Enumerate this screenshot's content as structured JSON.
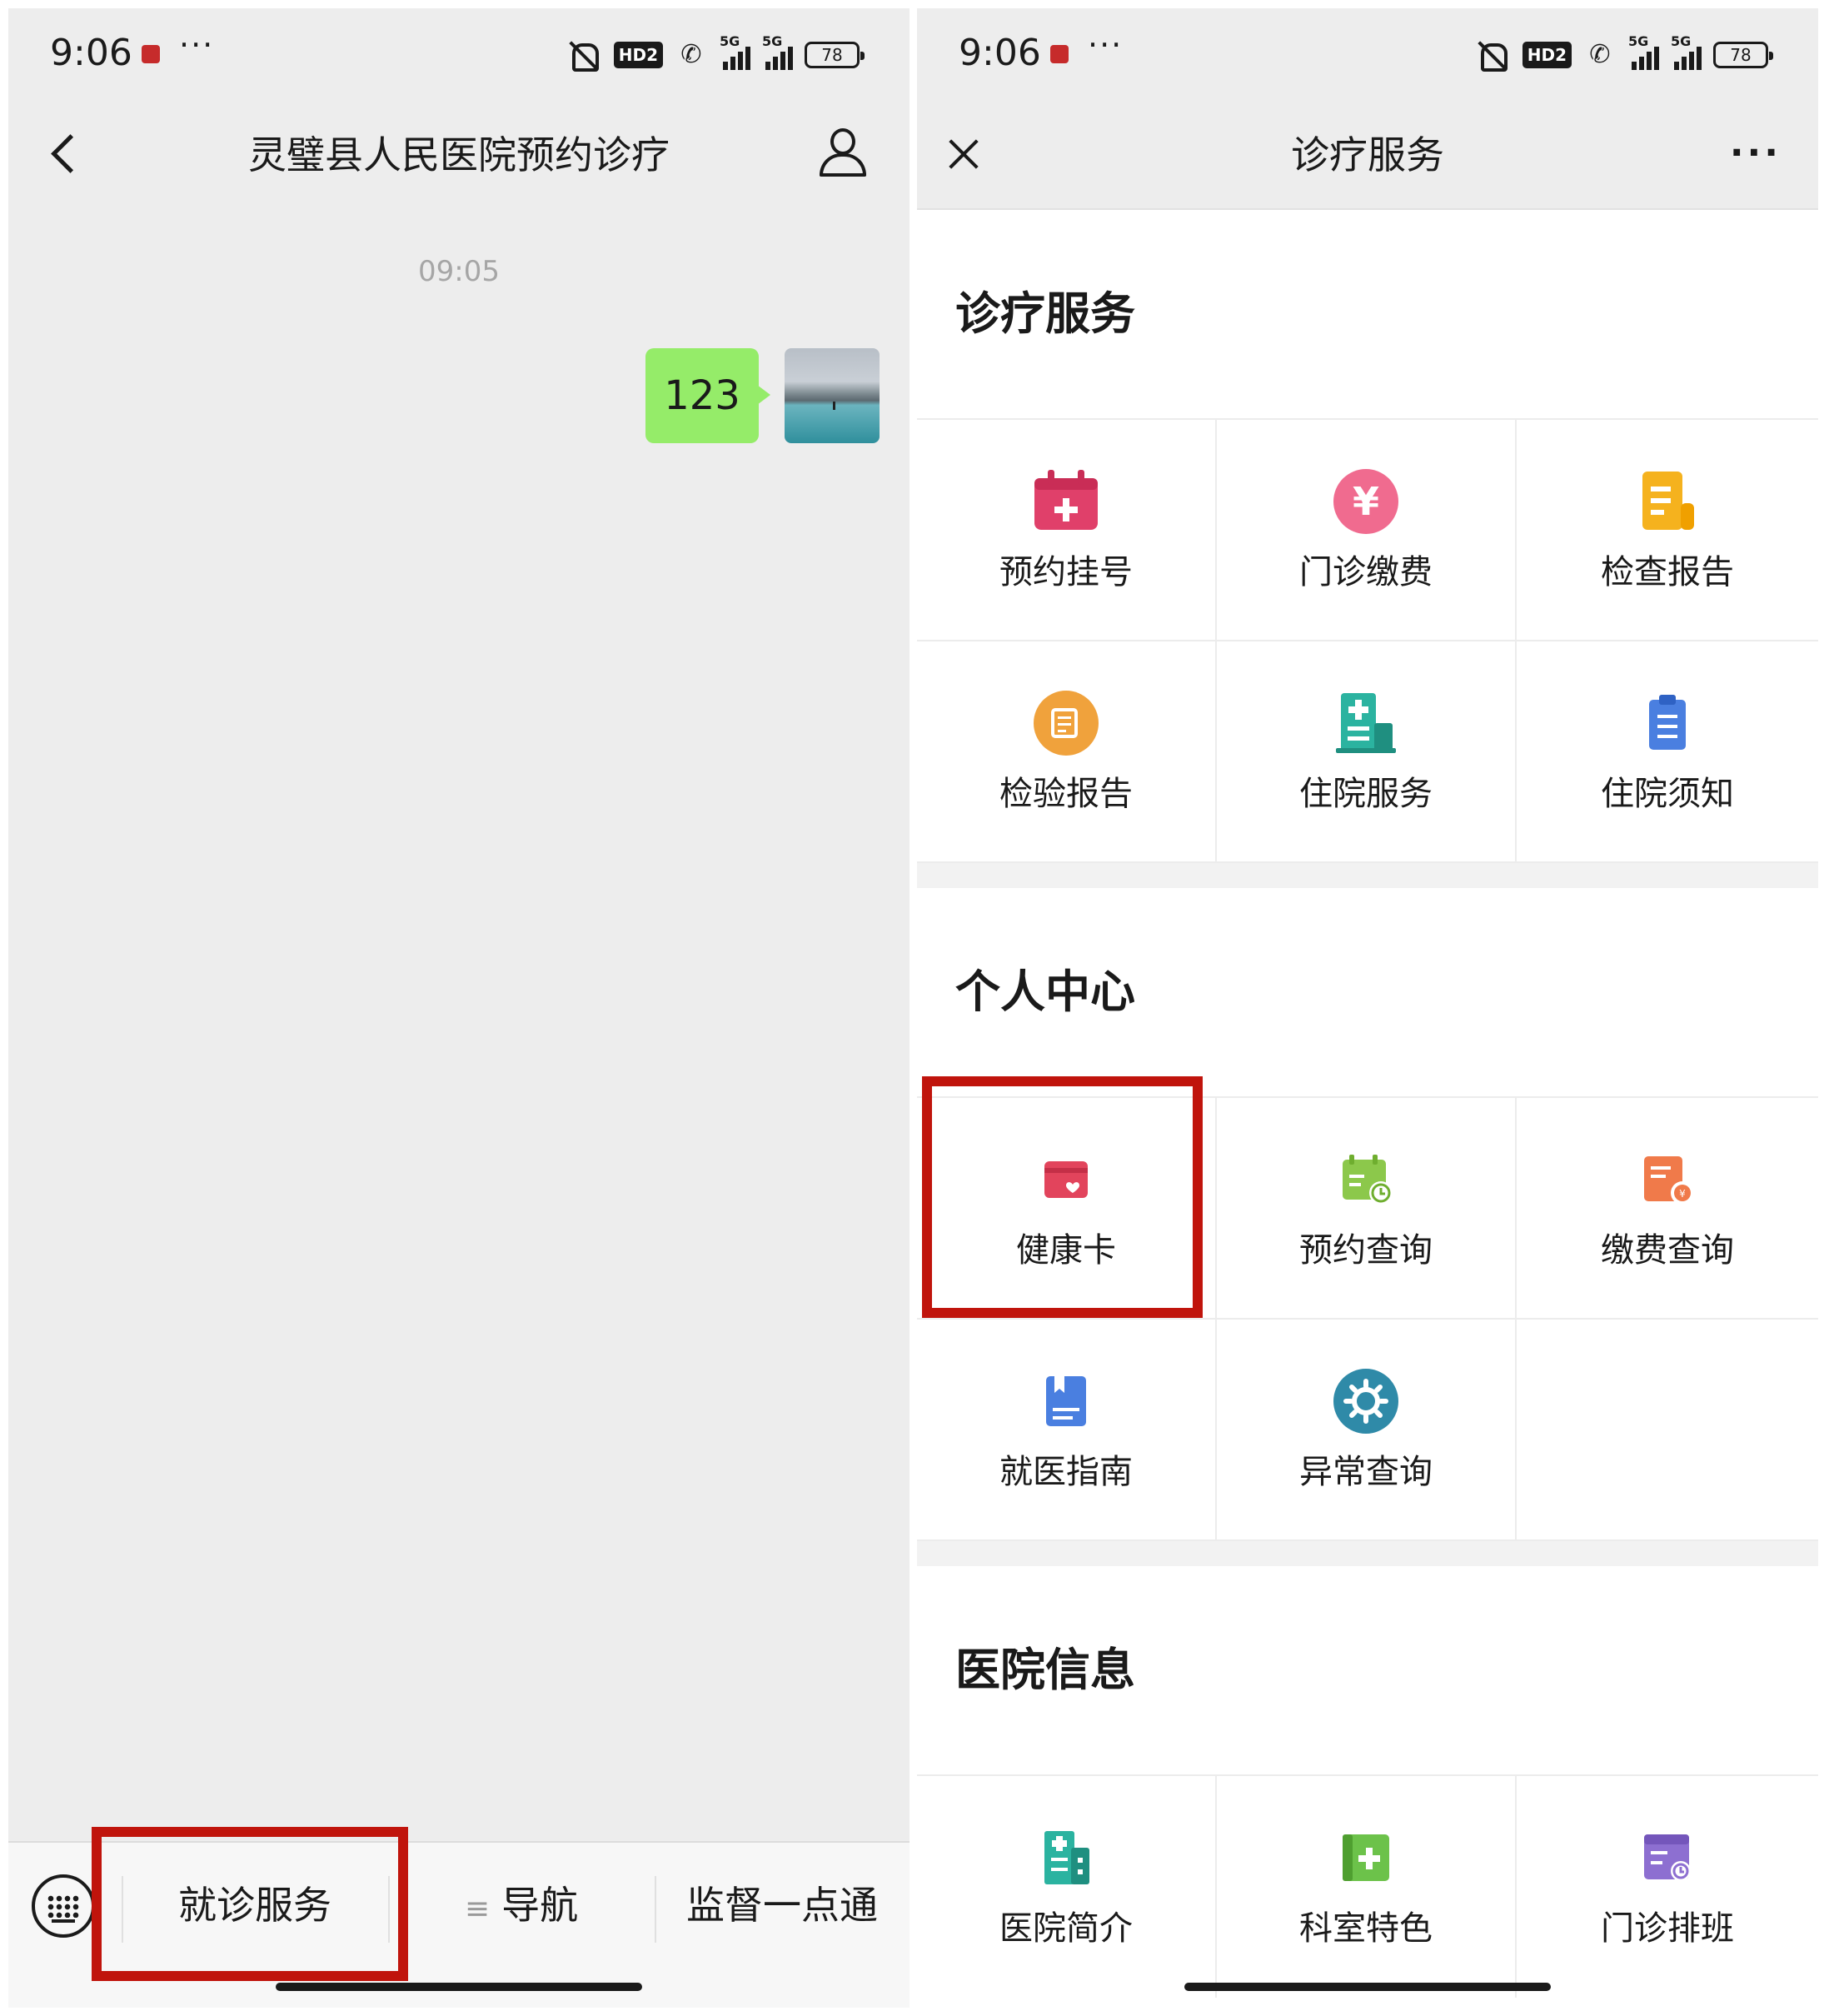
{
  "left": {
    "status": {
      "time": "9:06",
      "dots": "···",
      "hd": "HD2",
      "net1": "5G",
      "net2": "5G",
      "battery": "78"
    },
    "nav": {
      "title": "灵璧县人民医院预约诊疗"
    },
    "chat": {
      "timestamp": "09:05",
      "message": "123"
    },
    "menu": [
      {
        "label": "就诊服务"
      },
      {
        "label": "导航",
        "prefix": "≡"
      },
      {
        "label": "监督一点通"
      }
    ]
  },
  "right": {
    "status": {
      "time": "9:06",
      "dots": "···",
      "hd": "HD2",
      "net1": "5G",
      "net2": "5G",
      "battery": "78"
    },
    "nav": {
      "title": "诊疗服务",
      "more": "···"
    },
    "sections": [
      {
        "title": "诊疗服务",
        "items": [
          {
            "label": "预约挂号",
            "icon": "calendar-plus-icon",
            "color": "#e0406a"
          },
          {
            "label": "门诊缴费",
            "icon": "yen-coin-icon",
            "color": "#f06b8f"
          },
          {
            "label": "检查报告",
            "icon": "scroll-report-icon",
            "color": "#f5b21e"
          },
          {
            "label": "检验报告",
            "icon": "document-circle-icon",
            "color": "#f0a23c"
          },
          {
            "label": "住院服务",
            "icon": "hospital-bed-icon",
            "color": "#2bb3a0"
          },
          {
            "label": "住院须知",
            "icon": "clipboard-icon",
            "color": "#4a7fe0"
          }
        ]
      },
      {
        "title": "个人中心",
        "items": [
          {
            "label": "健康卡",
            "icon": "health-card-icon",
            "color": "#e2445c"
          },
          {
            "label": "预约查询",
            "icon": "calendar-clock-icon",
            "color": "#8cc84b"
          },
          {
            "label": "缴费查询",
            "icon": "bill-search-icon",
            "color": "#f07a4a"
          },
          {
            "label": "就医指南",
            "icon": "guide-book-icon",
            "color": "#4a7fe0"
          },
          {
            "label": "异常查询",
            "icon": "gear-circle-icon",
            "color": "#2f8aa8"
          }
        ]
      },
      {
        "title": "医院信息",
        "items": [
          {
            "label": "医院简介",
            "icon": "building-icon",
            "color": "#2bb3a0"
          },
          {
            "label": "科室特色",
            "icon": "medical-plus-icon",
            "color": "#6cc24a"
          },
          {
            "label": "门诊排班",
            "icon": "schedule-icon",
            "color": "#8d6fd1"
          }
        ]
      }
    ]
  },
  "colors": {
    "highlight": "#c0140c",
    "bubble": "#95ec69"
  }
}
